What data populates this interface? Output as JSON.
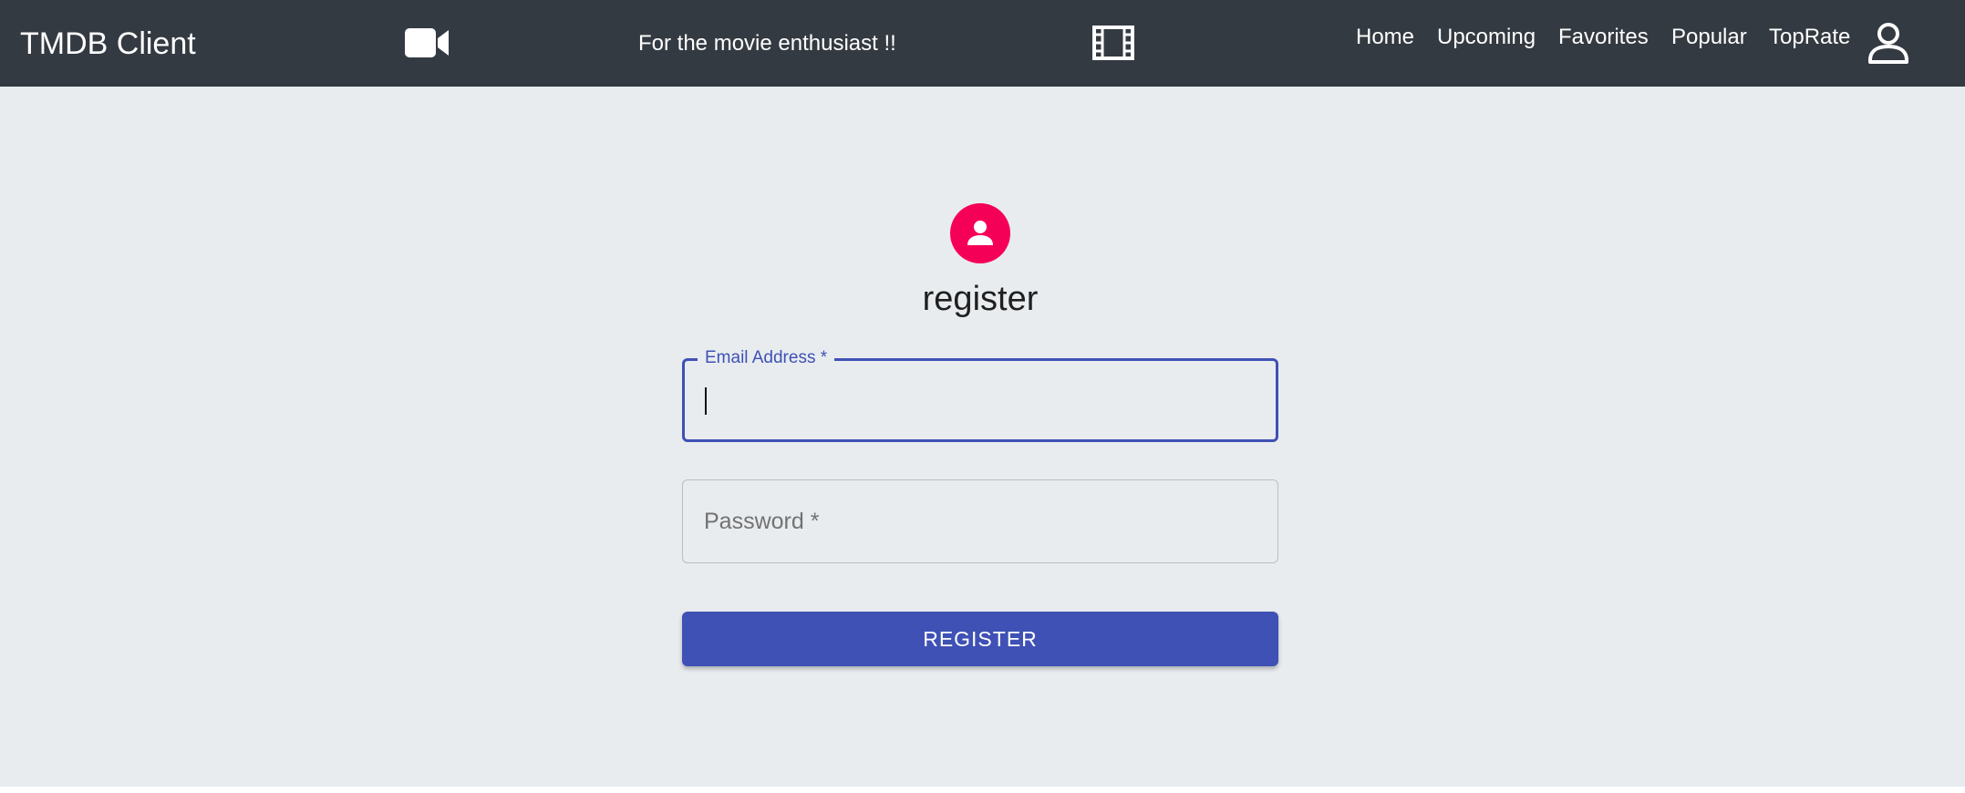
{
  "header": {
    "brand": "TMDB Client",
    "tagline": "For the movie enthusiast !!",
    "icons": {
      "left": "videocam-icon",
      "middle": "movie-film-icon",
      "account": "account-person-icon"
    },
    "nav": [
      "Home",
      "Upcoming",
      "Favorites",
      "Popular",
      "TopRate"
    ]
  },
  "form": {
    "avatar_icon": "person-avatar-icon",
    "title": "register",
    "email": {
      "label": "Email Address *",
      "value": ""
    },
    "password": {
      "placeholder": "Password *",
      "value": ""
    },
    "submit_label": "REGISTER"
  },
  "colors": {
    "appbar": "#343a42",
    "background": "#e8ecef",
    "primary": "#3f51b5",
    "avatar": "#f50057"
  }
}
